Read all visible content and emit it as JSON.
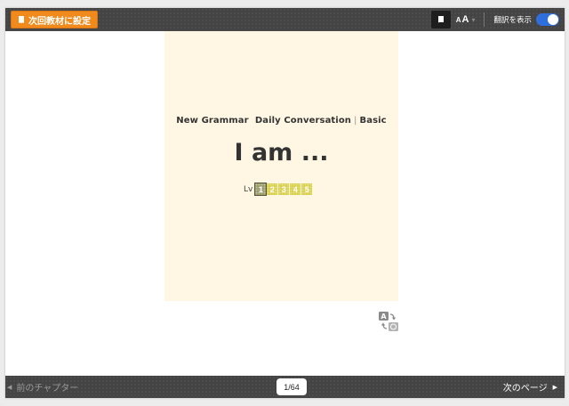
{
  "toolbar": {
    "set_next_material_label": "次回教材に設定",
    "font_size_small": "A",
    "font_size_large": "A",
    "show_translation_label": "翻訳を表示",
    "show_translation_on": true,
    "accent_color": "#f08a1c",
    "toggle_color": "#2f6fdd"
  },
  "material": {
    "series": [
      "New Grammar",
      "Daily Conversation",
      "Basic"
    ],
    "series_separator": "|",
    "title": "I am ...",
    "level_label": "Lv",
    "levels": [
      "1",
      "2",
      "3",
      "4",
      "5"
    ],
    "current_level": "1"
  },
  "footer": {
    "prev_chapter_label": "前のチャプター",
    "page_indicator": "1/64",
    "next_page_label": "次のページ"
  },
  "icons": {
    "set_next": "book-icon",
    "book_view": "book-icon",
    "translate": "translate-icon",
    "prev": "caret-left-icon",
    "next": "caret-right-icon"
  }
}
